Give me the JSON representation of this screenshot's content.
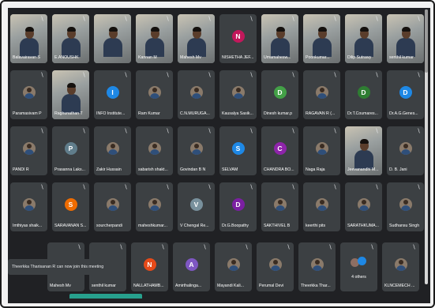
{
  "notification": "Theerkka Tharisanan R can now join this meeting",
  "participants": [
    {
      "name": "Balavairavan S",
      "kind": "cam"
    },
    {
      "name": "E.ANOUSHK",
      "kind": "cam"
    },
    {
      "name": "",
      "kind": "cam"
    },
    {
      "name": "Kannan M",
      "kind": "cam"
    },
    {
      "name": "Mahesh Mv",
      "kind": "cam"
    },
    {
      "name": "NISHETHA JEF...",
      "kind": "initial",
      "initial": "N",
      "color": "#c2185b"
    },
    {
      "name": "Umamahesw...",
      "kind": "cam"
    },
    {
      "name": "Poonkumar...",
      "kind": "cam"
    },
    {
      "name": "Dilip Sutrawy",
      "kind": "cam"
    },
    {
      "name": "senthil kumar",
      "kind": "cam"
    },
    {
      "name": "Paramasivam P",
      "kind": "photo"
    },
    {
      "name": "Raghunathan T",
      "kind": "cam"
    },
    {
      "name": "INFO Institute...",
      "kind": "initial",
      "initial": "I",
      "color": "#1e88e5"
    },
    {
      "name": "Ram Kumar",
      "kind": "photo"
    },
    {
      "name": "C.N.MURUGA...",
      "kind": "photo"
    },
    {
      "name": "Kausalya Sasik...",
      "kind": "photo"
    },
    {
      "name": "Dinesh kumar.p",
      "kind": "initial",
      "initial": "D",
      "color": "#43a047"
    },
    {
      "name": "RAGAVAN R (...",
      "kind": "photo"
    },
    {
      "name": "Dr.T.Coumares...",
      "kind": "initial",
      "initial": "D",
      "color": "#2e7d32"
    },
    {
      "name": "Dr.A.G.Genes...",
      "kind": "initial",
      "initial": "D",
      "color": "#1e88e5"
    },
    {
      "name": "PANDI R",
      "kind": "photo"
    },
    {
      "name": "Prasanna Laks...",
      "kind": "initial",
      "initial": "P",
      "color": "#607d8b"
    },
    {
      "name": "Zakir Hussain",
      "kind": "photo"
    },
    {
      "name": "sabarish shakt...",
      "kind": "photo"
    },
    {
      "name": "Govindan B N",
      "kind": "photo"
    },
    {
      "name": "SELVAM",
      "kind": "initial",
      "initial": "S",
      "color": "#1e88e5"
    },
    {
      "name": "CHANDRA BO...",
      "kind": "initial",
      "initial": "C",
      "color": "#8e24aa"
    },
    {
      "name": "Naga Raja",
      "kind": "photo"
    },
    {
      "name": "Jeevanandhi M...",
      "kind": "cam"
    },
    {
      "name": "D. B. Jani",
      "kind": "photo"
    },
    {
      "name": "Imthiyas shaik...",
      "kind": "photo"
    },
    {
      "name": "SARAVANAN S...",
      "kind": "initial",
      "initial": "S",
      "color": "#ef6c00"
    },
    {
      "name": "sourcherpandi",
      "kind": "photo"
    },
    {
      "name": "maheshkumar...",
      "kind": "photo"
    },
    {
      "name": "V Chengal Re...",
      "kind": "initial",
      "initial": "V",
      "color": "#78909c"
    },
    {
      "name": "Dr.G.Boopathy",
      "kind": "initial",
      "initial": "D",
      "color": "#7b1fa2"
    },
    {
      "name": "SAKTHIVEL B",
      "kind": "photo"
    },
    {
      "name": "keerthi pits",
      "kind": "photo"
    },
    {
      "name": "SARATHKUMA...",
      "kind": "photo"
    },
    {
      "name": "Sudhansu Singh",
      "kind": "photo"
    },
    {
      "name": "Mahesh Mv",
      "kind": "blank"
    },
    {
      "name": "senthil kumar",
      "kind": "blank"
    },
    {
      "name": "NALLATHAMB...",
      "kind": "initial",
      "initial": "N",
      "color": "#e64a19"
    },
    {
      "name": "Amirthalinga...",
      "kind": "initial",
      "initial": "A",
      "color": "#7e57c2"
    },
    {
      "name": "Mayandi Kali...",
      "kind": "photo"
    },
    {
      "name": "Perumal Devi",
      "kind": "photo"
    },
    {
      "name": "Theerkka Thar...",
      "kind": "photo"
    },
    {
      "name": "4 others",
      "kind": "others"
    },
    {
      "name": "KLNCEMECH ...",
      "kind": "photo"
    }
  ]
}
